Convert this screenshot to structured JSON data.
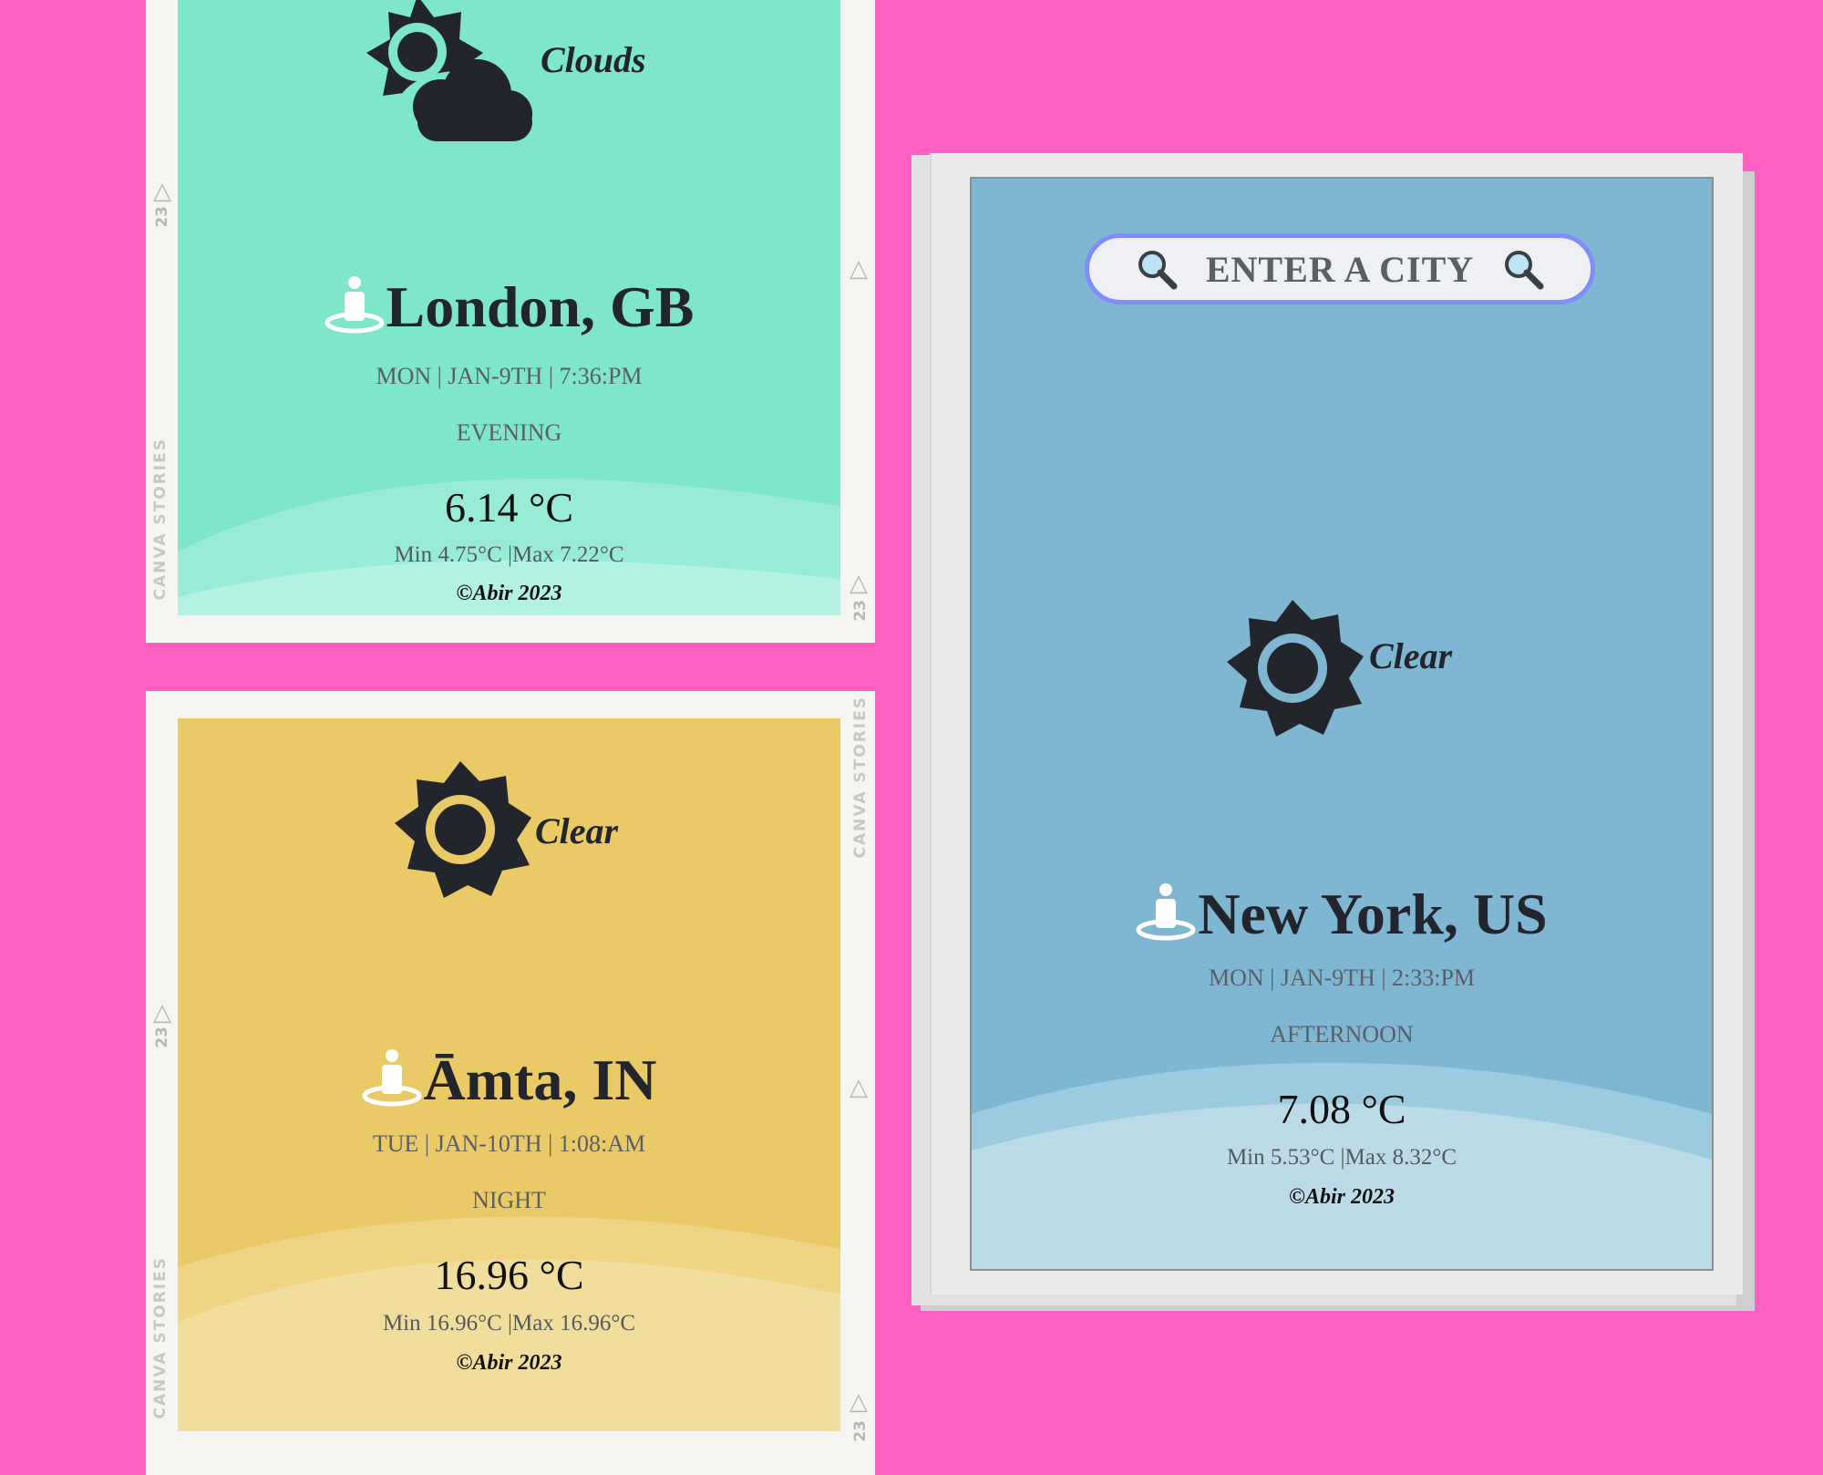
{
  "cards": [
    {
      "condition": "Clouds",
      "location": "London, GB",
      "datetime": "MON | JAN-9TH | 7:36:PM",
      "period": "EVENING",
      "temperature": "6.14 °C",
      "minmax": "Min 4.75°C |Max 7.22°C",
      "credit": "©Abir 2023",
      "bg": "#7de6cb",
      "icon": "sun-cloud-icon"
    },
    {
      "condition": "Clear",
      "location": "Āmta, IN",
      "datetime": "TUE | JAN-10TH | 1:08:AM",
      "period": "NIGHT",
      "temperature": "16.96 °C",
      "minmax": "Min 16.96°C |Max 16.96°C",
      "credit": "©Abir 2023",
      "bg": "#eaca66",
      "icon": "sun-icon"
    },
    {
      "condition": "Clear",
      "location": "New York, US",
      "datetime": "MON | JAN-9TH | 2:33:PM",
      "period": "AFTERNOON",
      "temperature": "7.08 °C",
      "minmax": "Min 5.53°C |Max 8.32°C",
      "credit": "©Abir 2023",
      "bg": "#7fb7d3",
      "icon": "sun-icon"
    }
  ],
  "search": {
    "placeholder": "ENTER A CITY"
  },
  "frame_marks": {
    "brand": "CANVA STORIES",
    "number": "23"
  },
  "colors": {
    "background": "#ff60c2",
    "search_border": "#7f8dfa",
    "text_dark": "#22252b"
  }
}
